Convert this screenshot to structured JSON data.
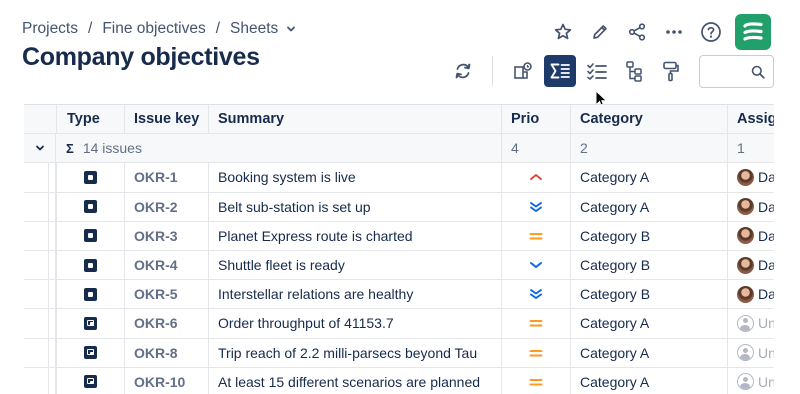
{
  "breadcrumb": {
    "items": [
      "Projects",
      "Fine objectives",
      "Sheets"
    ],
    "separator": "/"
  },
  "page": {
    "title": "Company objectives"
  },
  "header_icons": [
    "star-icon",
    "pencil-icon",
    "share-icon",
    "more-icon",
    "help-icon",
    "app-logo"
  ],
  "toolbar": {
    "buttons": [
      "refresh-icon",
      "hierarchy-view-icon",
      "sum-icon",
      "checklist-icon",
      "tree-icon",
      "paint-roller-icon"
    ],
    "active": "sum-icon",
    "search": {
      "value": "",
      "placeholder": ""
    }
  },
  "grid": {
    "columns": [
      "Type",
      "Issue key",
      "Summary",
      "Prio",
      "Category",
      "Assig"
    ],
    "group": {
      "sigma": "Σ",
      "issues_label": "14 issues",
      "prio_count": "4",
      "category_count": "2",
      "assignee_count": "1"
    },
    "rows": [
      {
        "type": "epic",
        "key": "OKR-1",
        "summary": "Booking system is live",
        "prio": "high",
        "category": "Category A",
        "assignee": "Da",
        "assigned": true
      },
      {
        "type": "epic",
        "key": "OKR-2",
        "summary": "Belt sub-station is set up",
        "prio": "lowest",
        "category": "Category A",
        "assignee": "Da",
        "assigned": true
      },
      {
        "type": "epic",
        "key": "OKR-3",
        "summary": "Planet Express route is charted",
        "prio": "medium",
        "category": "Category B",
        "assignee": "Da",
        "assigned": true
      },
      {
        "type": "epic",
        "key": "OKR-4",
        "summary": "Shuttle fleet is ready",
        "prio": "low",
        "category": "Category B",
        "assignee": "Da",
        "assigned": true
      },
      {
        "type": "epic",
        "key": "OKR-5",
        "summary": "Interstellar relations are healthy",
        "prio": "lowest",
        "category": "Category B",
        "assignee": "Da",
        "assigned": true
      },
      {
        "type": "subtask",
        "key": "OKR-6",
        "summary": "Order throughput of 41153.7",
        "prio": "medium",
        "category": "Category A",
        "assignee": "Un",
        "assigned": false
      },
      {
        "type": "subtask",
        "key": "OKR-8",
        "summary": "Trip reach of 2.2 milli-parsecs beyond Tau",
        "prio": "medium",
        "category": "Category A",
        "assignee": "Un",
        "assigned": false
      },
      {
        "type": "subtask",
        "key": "OKR-10",
        "summary": "At least 15 different scenarios are planned",
        "prio": "medium",
        "category": "Category A",
        "assignee": "Un",
        "assigned": false
      }
    ]
  },
  "colors": {
    "prio_high": "#e2483d",
    "prio_medium": "#ff991f",
    "prio_low": "#0c66e4",
    "active_button": "#1d3a68",
    "logo": "#22a06b"
  }
}
